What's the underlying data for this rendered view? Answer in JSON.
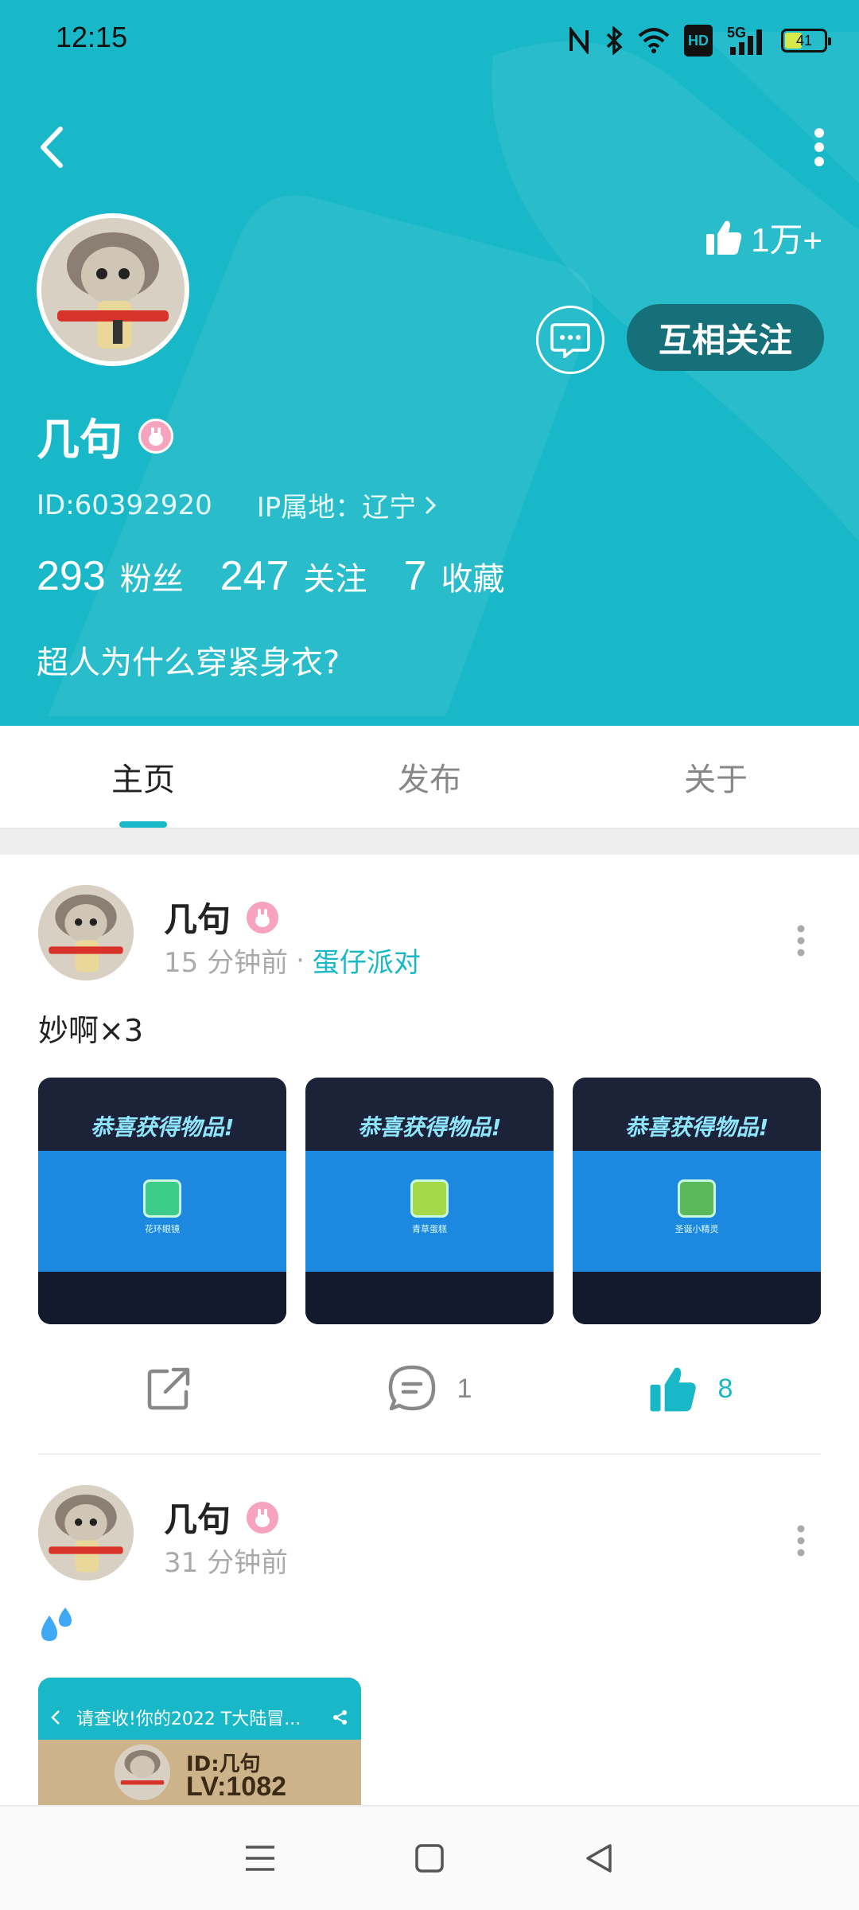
{
  "status_bar": {
    "time": "12:15",
    "network_label": "HD",
    "signal_label": "5G",
    "battery": "41",
    "battery_level": 0.41
  },
  "profile": {
    "likes": "1万+",
    "follow_label": "互相关注",
    "name": "几句",
    "id_text": "ID:60392920",
    "ip_text": "IP属地：辽宁",
    "stats": [
      {
        "num": "293",
        "label": "粉丝"
      },
      {
        "num": "247",
        "label": "关注"
      },
      {
        "num": "7",
        "label": "收藏"
      }
    ],
    "bio": "超人为什么穿紧身衣?"
  },
  "tabs": [
    "主页",
    "发布",
    "关于"
  ],
  "posts": [
    {
      "author": "几句",
      "time": "15 分钟前",
      "separator": "·",
      "topic": "蛋仔派对",
      "text": "妙啊×3",
      "images": [
        {
          "banner": "恭喜获得物品!",
          "item": "花环眼镜"
        },
        {
          "banner": "恭喜获得物品!",
          "item": "青草蛋糕"
        },
        {
          "banner": "恭喜获得物品!",
          "item": "圣诞小精灵"
        }
      ],
      "comments": "1",
      "likes": "8"
    },
    {
      "author": "几句",
      "time": "31 分钟前",
      "text": "💦",
      "card_title": "请查收!你的2022 T大陆冒...",
      "card_id": "ID:几句",
      "card_lv": "LV:1082"
    }
  ],
  "colors": {
    "accent": "#19b8c8",
    "follow_bg": "#15707a",
    "badge": "#f7a3c0"
  }
}
